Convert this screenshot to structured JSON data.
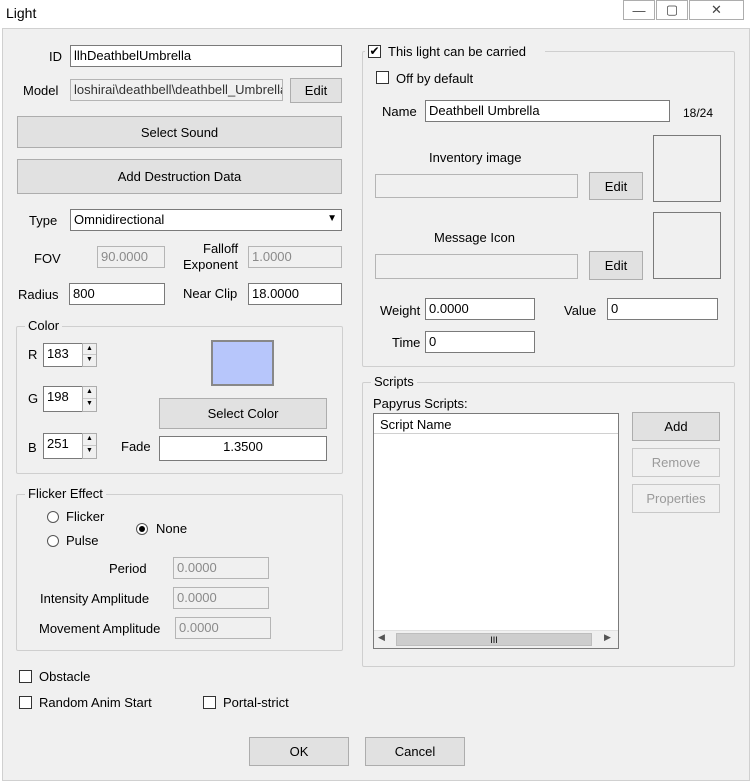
{
  "window": {
    "title": "Light",
    "min": "—",
    "max": "▢",
    "close": "✕"
  },
  "id": {
    "label": "ID",
    "value": "llhDeathbelUmbrella"
  },
  "model": {
    "label": "Model",
    "value": "loshirai\\deathbell\\deathbell_Umbrella.nif",
    "edit": "Edit"
  },
  "buttons": {
    "select_sound": "Select Sound",
    "add_destruction": "Add Destruction Data"
  },
  "type": {
    "label": "Type",
    "value": "Omnidirectional"
  },
  "fov": {
    "label": "FOV",
    "value": "90.0000"
  },
  "falloff": {
    "label1": "Falloff",
    "label2": "Exponent",
    "value": "1.0000"
  },
  "radius": {
    "label": "Radius",
    "value": "800"
  },
  "nearclip": {
    "label": "Near Clip",
    "value": "18.0000"
  },
  "color": {
    "group": "Color",
    "r_label": "R",
    "r": "183",
    "g_label": "G",
    "g": "198",
    "b_label": "B",
    "b": "251",
    "swatch": "#b7c6fb",
    "select": "Select Color",
    "fade_label": "Fade",
    "fade": "1.3500"
  },
  "flicker": {
    "group": "Flicker Effect",
    "flicker": "Flicker",
    "pulse": "Pulse",
    "none": "None",
    "period_label": "Period",
    "period": "0.0000",
    "intensity_label": "Intensity Amplitude",
    "intensity": "0.0000",
    "movement_label": "Movement Amplitude",
    "movement": "0.0000"
  },
  "checks": {
    "obstacle": "Obstacle",
    "random_anim": "Random Anim Start",
    "portal": "Portal-strict"
  },
  "carry": {
    "carried": "This light can be carried",
    "off_default": "Off by default",
    "name_label": "Name",
    "name": "Deathbell Umbrella",
    "count": "18/24",
    "inventory_label": "Inventory image",
    "inventory_edit": "Edit",
    "message_label": "Message Icon",
    "message_edit": "Edit",
    "weight_label": "Weight",
    "weight": "0.0000",
    "value_label": "Value",
    "value": "0",
    "time_label": "Time",
    "time": "0"
  },
  "scripts": {
    "group": "Scripts",
    "papyrus": "Papyrus Scripts:",
    "column": "Script Name",
    "add": "Add",
    "remove": "Remove",
    "properties": "Properties",
    "scroll_thumb": "III"
  },
  "footer": {
    "ok": "OK",
    "cancel": "Cancel"
  }
}
